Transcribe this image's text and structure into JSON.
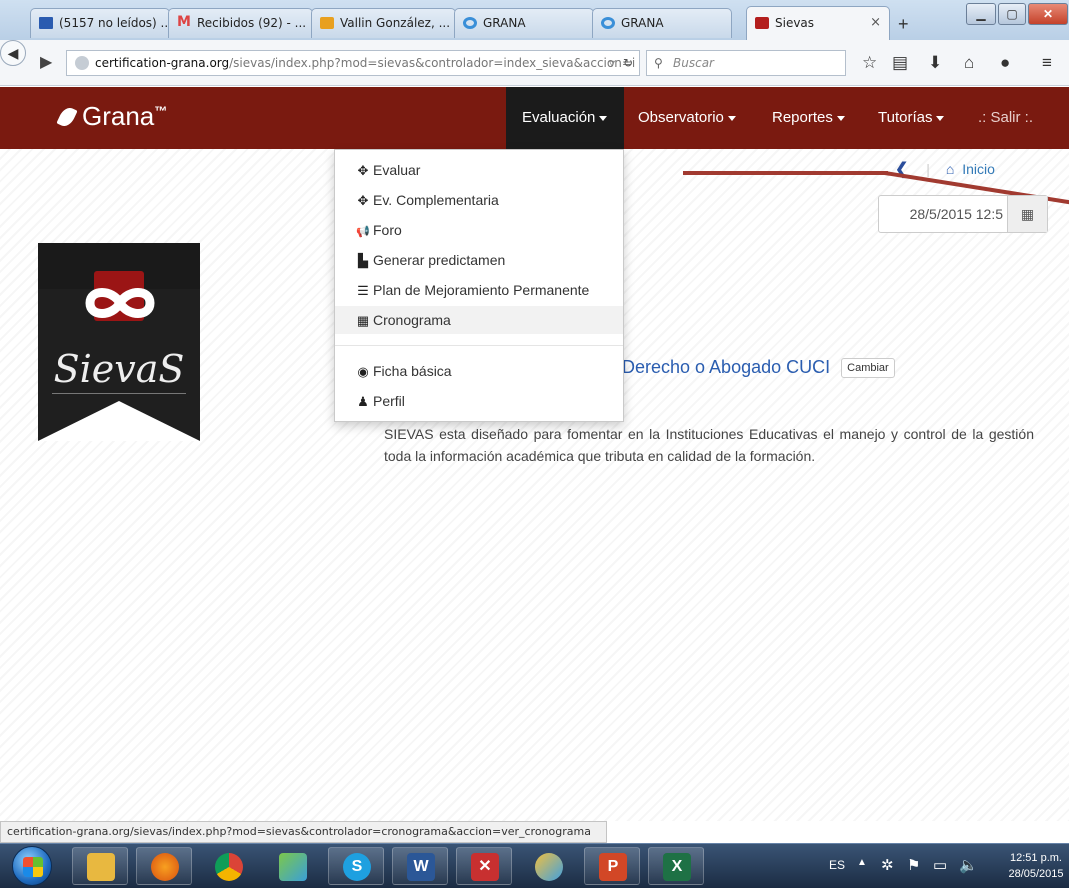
{
  "browser": {
    "tabs": [
      {
        "label": "(5157 no leídos) ...",
        "icon": "mail-icon"
      },
      {
        "label": "Recibidos (92) - ...",
        "icon": "gmail-icon"
      },
      {
        "label": "Vallin González, ...",
        "icon": "outlook-icon"
      },
      {
        "label": "GRANA",
        "icon": "grana-icon"
      },
      {
        "label": "GRANA",
        "icon": "grana-icon"
      },
      {
        "label": "Sievas",
        "icon": "sievas-icon"
      }
    ],
    "close_tab": "×",
    "new_tab": "+",
    "url_host": "certification-grana.org",
    "url_path": "/sievas/index.php?mod=sievas&controlador=index_sieva&accion=i",
    "search_placeholder": "Buscar",
    "toolbar_icons": [
      "star-icon",
      "reading-list-icon",
      "download-icon",
      "home-icon",
      "chat-icon",
      "menu-icon"
    ]
  },
  "site": {
    "brand": "Grana",
    "trademark": "™",
    "menu": [
      {
        "label": "Evaluación",
        "active": true
      },
      {
        "label": "Observatorio"
      },
      {
        "label": "Reportes"
      },
      {
        "label": "Tutorías"
      },
      {
        "label": ".: Salir :."
      }
    ],
    "dropdown": [
      {
        "label": "Evaluar",
        "icon": "move-icon",
        "glyph": "✥"
      },
      {
        "label": "Ev. Complementaria",
        "icon": "move-icon",
        "glyph": "✥"
      },
      {
        "label": "Foro",
        "icon": "bullhorn-icon",
        "glyph": "📢"
      },
      {
        "label": "Generar predictamen",
        "icon": "file-icon",
        "glyph": "▙"
      },
      {
        "label": "Plan de Mejoramiento Permanente",
        "icon": "tasks-icon",
        "glyph": "☰"
      },
      {
        "label": "Cronograma",
        "icon": "calendar-icon",
        "glyph": "▦",
        "highlighted": true
      },
      {
        "label": "Ficha básica",
        "icon": "eye-icon",
        "glyph": "◉"
      },
      {
        "label": "Perfil",
        "icon": "user-icon",
        "glyph": "♟"
      }
    ],
    "breadcrumb": {
      "back": "❮",
      "home": "Inicio"
    },
    "date_value": "28/5/2015 12:5",
    "logo_text": "SievaS",
    "institution": "Derecho o Abogado CUCI",
    "change_button": "Cambiar",
    "description": "SIEVAS esta diseñado para fomentar en la Instituciones Educativas el manejo y control de la gestión toda la información académica que tributa en calidad de la formación."
  },
  "status_url": "certification-grana.org/sievas/index.php?mod=sievas&controlador=cronograma&accion=ver_cronograma",
  "taskbar": {
    "apps": [
      "explorer",
      "firefox",
      "chrome",
      "app-green",
      "skype",
      "word",
      "app-red",
      "paint",
      "powerpoint",
      "excel"
    ],
    "language": "ES",
    "time": "12:51 p.m.",
    "date": "28/05/2015"
  }
}
